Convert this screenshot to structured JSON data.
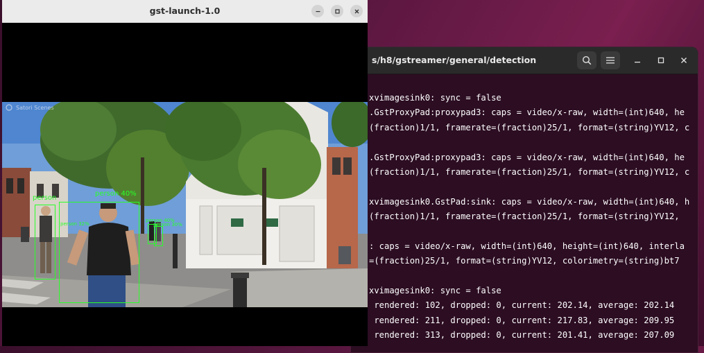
{
  "gst_window": {
    "title": "gst-launch-1.0",
    "watermark": "Satori Scenes",
    "detections": [
      {
        "label": "person"
      },
      {
        "label": "person 32%"
      },
      {
        "label": "person 40%"
      },
      {
        "label": "person 30%"
      }
    ],
    "detection_top_label": "person 40%"
  },
  "terminal": {
    "title": "s/h8/gstreamer/general/detection",
    "lines": [
      "xvimagesink0: sync = false",
      ".GstProxyPad:proxypad3: caps = video/x-raw, width=(int)640, he",
      "(fraction)1/1, framerate=(fraction)25/1, format=(string)YV12, c",
      "",
      ".GstProxyPad:proxypad3: caps = video/x-raw, width=(int)640, he",
      "(fraction)1/1, framerate=(fraction)25/1, format=(string)YV12, c",
      "",
      "xvimagesink0.GstPad:sink: caps = video/x-raw, width=(int)640, h",
      "(fraction)1/1, framerate=(fraction)25/1, format=(string)YV12,",
      "",
      ": caps = video/x-raw, width=(int)640, height=(int)640, interla",
      "=(fraction)25/1, format=(string)YV12, colorimetry=(string)bt7",
      "",
      "xvimagesink0: sync = false",
      " rendered: 102, dropped: 0, current: 202.14, average: 202.14",
      " rendered: 211, dropped: 0, current: 217.83, average: 209.95",
      " rendered: 313, dropped: 0, current: 201.41, average: 207.09"
    ]
  },
  "colors": {
    "desktop": "#5a1740",
    "terminal_bg": "#2c0d22",
    "detection_box": "#28ff28"
  }
}
